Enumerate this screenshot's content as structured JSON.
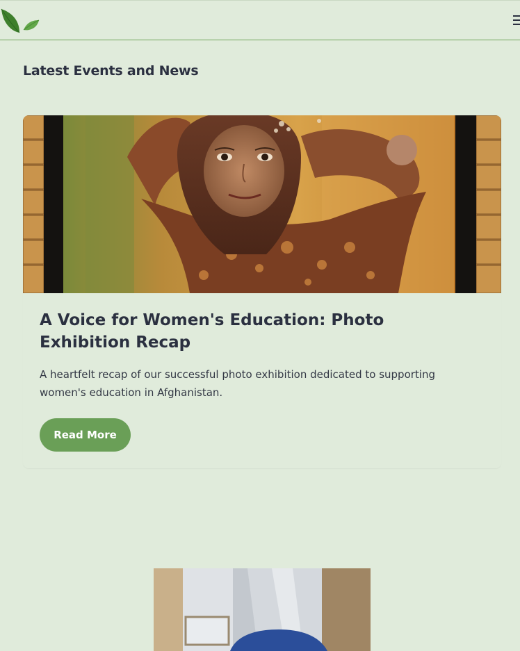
{
  "header": {
    "logo_icon": "leaf-icon",
    "menu_icon": "hamburger-icon"
  },
  "section": {
    "title": "Latest Events and News"
  },
  "posts": [
    {
      "title": "A Voice for Women's Education: Photo Exhibition Recap",
      "excerpt": "A heartfelt recap of our successful photo exhibition dedicated to supporting women's education in Afghanistan.",
      "button_label": "Read More"
    }
  ],
  "colors": {
    "background": "#e0ebdb",
    "accent": "#6a9f57",
    "text": "#2b3040"
  }
}
